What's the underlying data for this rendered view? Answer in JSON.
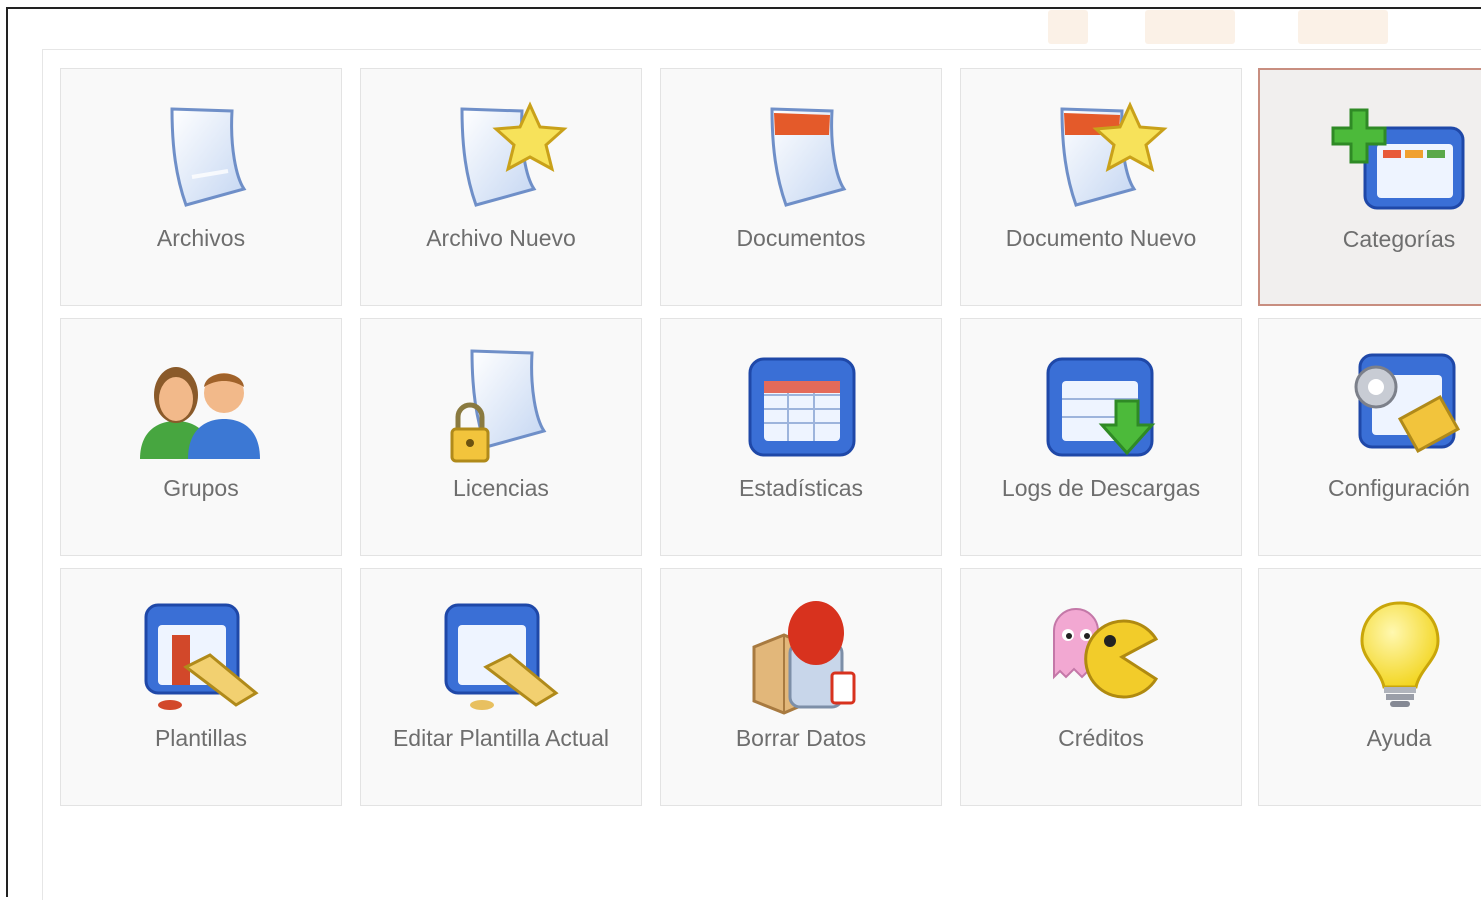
{
  "tiles": [
    {
      "label": "Archivos",
      "icon": "file-icon"
    },
    {
      "label": "Archivo Nuevo",
      "icon": "new-file-icon"
    },
    {
      "label": "Documentos",
      "icon": "document-icon"
    },
    {
      "label": "Documento Nuevo",
      "icon": "new-document-icon"
    },
    {
      "label": "Categorías",
      "icon": "categories-icon"
    },
    {
      "label": "Grupos",
      "icon": "groups-icon"
    },
    {
      "label": "Licencias",
      "icon": "license-lock-icon"
    },
    {
      "label": "Estadísticas",
      "icon": "statistics-icon"
    },
    {
      "label": "Logs de Descargas",
      "icon": "download-logs-icon"
    },
    {
      "label": "Configuración",
      "icon": "configuration-icon"
    },
    {
      "label": "Plantillas",
      "icon": "templates-icon"
    },
    {
      "label": "Editar Plantilla Actual",
      "icon": "edit-template-icon"
    },
    {
      "label": "Borrar Datos",
      "icon": "delete-data-icon"
    },
    {
      "label": "Créditos",
      "icon": "credits-icon"
    },
    {
      "label": "Ayuda",
      "icon": "help-lightbulb-icon"
    }
  ],
  "active_tile": "Categorías",
  "colors": {
    "tile_bg": "#f9f9f9",
    "active_border": "#c88e80",
    "label": "#6e6e6e"
  }
}
